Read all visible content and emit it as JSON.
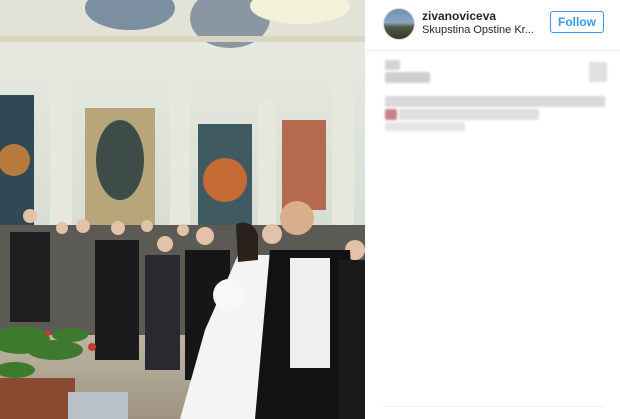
{
  "post": {
    "username": "zivanoviceva",
    "location": "Skupstina Opstine Kr...",
    "follow_label": "Follow"
  },
  "photo": {
    "description_icon": "wedding-photo-icon"
  },
  "colors": {
    "accent": "#3897f0",
    "text": "#262626",
    "divider": "#efefef"
  }
}
